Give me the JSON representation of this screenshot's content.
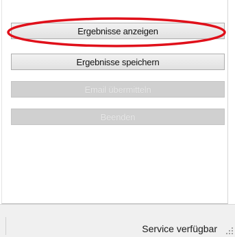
{
  "buttons": {
    "show_results": "Ergebnisse anzeigen",
    "save_results": "Ergebnisse speichern",
    "send_email": "Email übermitteln",
    "finish": "Beenden"
  },
  "status": {
    "text": "Service verfügbar"
  },
  "colors": {
    "highlight": "#e0101a",
    "button_face": "#e8e8e8",
    "disabled_face": "#d0d0d0"
  }
}
